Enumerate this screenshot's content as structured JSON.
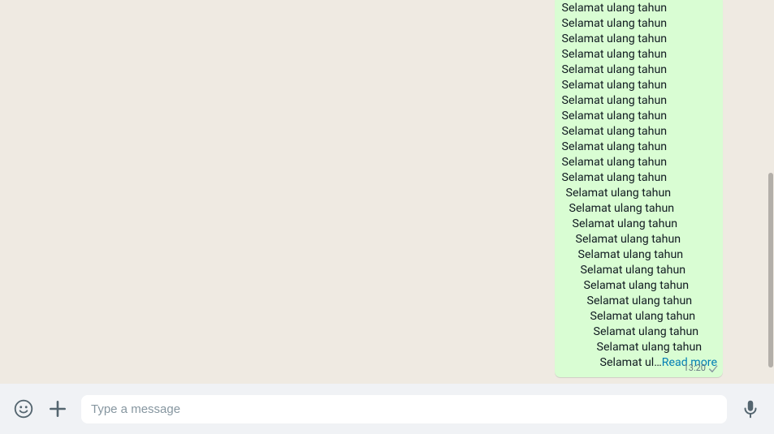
{
  "chat": {
    "bubble": {
      "lines": [
        {
          "text": "Selamat ulang tahun",
          "indent": 0
        },
        {
          "text": "Selamat ulang tahun",
          "indent": 0
        },
        {
          "text": "Selamat ulang tahun",
          "indent": 0
        },
        {
          "text": "Selamat ulang tahun",
          "indent": 0
        },
        {
          "text": "Selamat ulang tahun",
          "indent": 0
        },
        {
          "text": "Selamat ulang tahun",
          "indent": 0
        },
        {
          "text": "Selamat ulang tahun",
          "indent": 0
        },
        {
          "text": "Selamat ulang tahun",
          "indent": 0
        },
        {
          "text": "Selamat ulang tahun",
          "indent": 0
        },
        {
          "text": "Selamat ulang tahun",
          "indent": 0
        },
        {
          "text": "Selamat ulang tahun",
          "indent": 0
        },
        {
          "text": "Selamat ulang tahun",
          "indent": 0
        },
        {
          "text": "Selamat ulang tahun",
          "indent": 5
        },
        {
          "text": "Selamat ulang tahun",
          "indent": 9
        },
        {
          "text": "Selamat ulang tahun",
          "indent": 13
        },
        {
          "text": "Selamat ulang tahun",
          "indent": 17
        },
        {
          "text": "Selamat ulang tahun",
          "indent": 20
        },
        {
          "text": "Selamat ulang tahun",
          "indent": 23
        },
        {
          "text": "Selamat ulang tahun",
          "indent": 27
        },
        {
          "text": "Selamat ulang tahun",
          "indent": 31
        },
        {
          "text": "Selamat ulang tahun",
          "indent": 35
        },
        {
          "text": "Selamat ulang tahun",
          "indent": 39
        },
        {
          "text": "Selamat ulang tahun",
          "indent": 43
        }
      ],
      "last_line_text": "Selamat ul…",
      "last_line_indent": 47,
      "read_more_label": "Read more",
      "time": "13:20"
    }
  },
  "composer": {
    "placeholder": "Type a message"
  },
  "icons": {
    "smiley": "smiley-icon",
    "attach": "plus-icon",
    "mic": "mic-icon",
    "check": "msg-check-icon"
  },
  "colors": {
    "bubble_bg": "#d9fdd3",
    "read_more": "#027eb5",
    "chat_bg": "#efeae2",
    "composer_bg": "#f0f2f5"
  }
}
